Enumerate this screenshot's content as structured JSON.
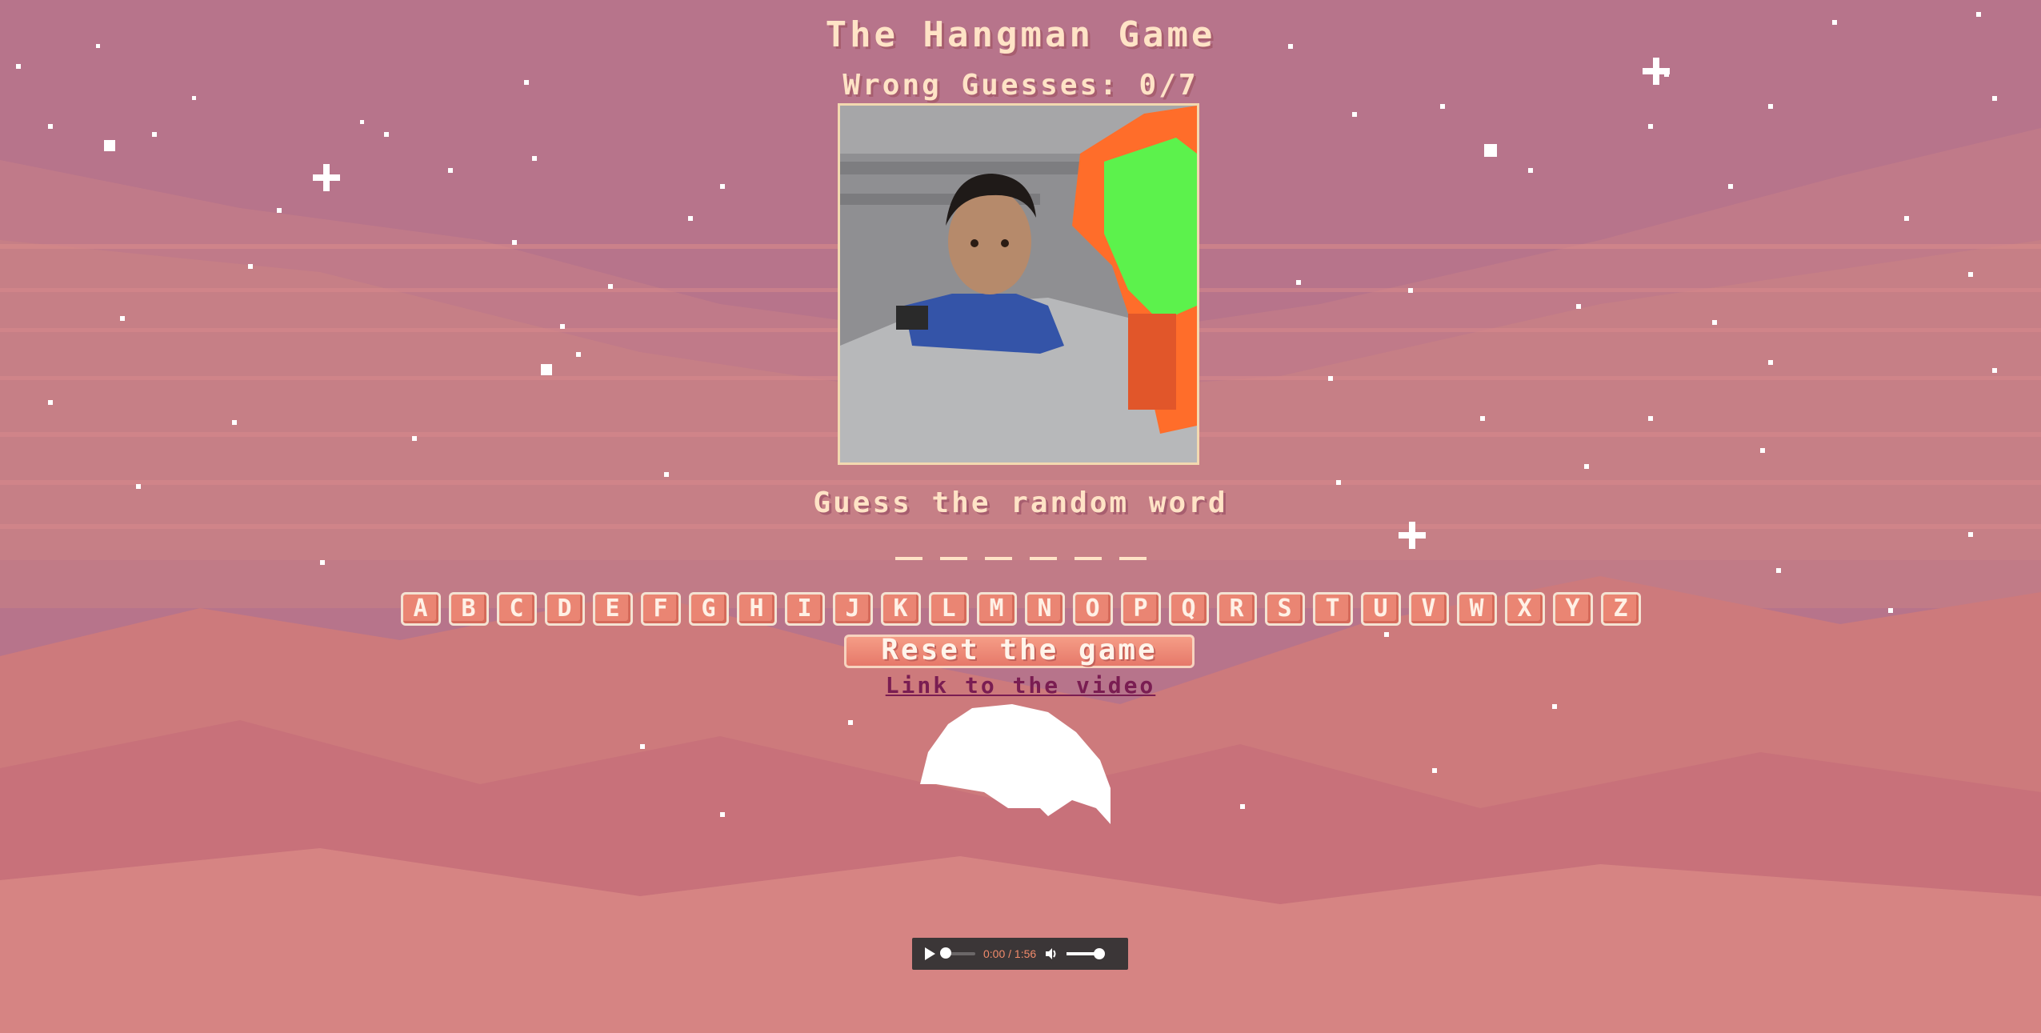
{
  "game": {
    "title": "The Hangman Game",
    "wrong_guesses": "Wrong Guesses: 0/7",
    "prompt": "Guess the random word",
    "word_blanks": [
      "_",
      "_",
      "_",
      "_",
      "_",
      "_"
    ],
    "letters": [
      "A",
      "B",
      "C",
      "D",
      "E",
      "F",
      "G",
      "H",
      "I",
      "J",
      "K",
      "L",
      "M",
      "N",
      "O",
      "P",
      "Q",
      "R",
      "S",
      "T",
      "U",
      "V",
      "W",
      "X",
      "Y",
      "Z"
    ],
    "reset_label": "Reset the game",
    "video_link_label": "Link to the video"
  },
  "audio": {
    "time": "0:00 / 1:56"
  },
  "colors": {
    "text": "#ffe3c6",
    "button": "#ea8573",
    "link": "#7a1d52"
  }
}
